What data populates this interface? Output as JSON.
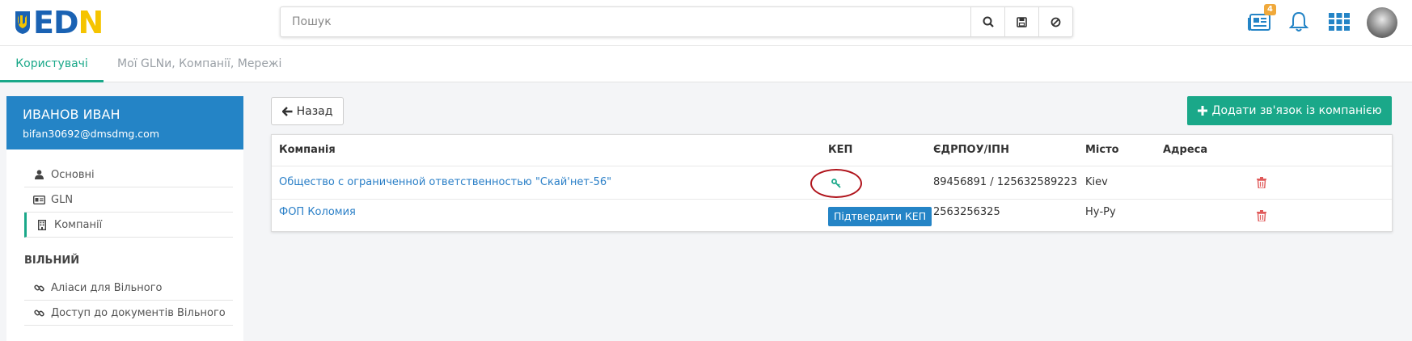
{
  "header": {
    "logo_text_1": "ED",
    "logo_text_2": "N",
    "search_placeholder": "Пошук",
    "notification_badge": "4",
    "icons": [
      "search-icon",
      "save-icon",
      "block-icon",
      "news-icon",
      "bell-icon",
      "apps-grid-icon",
      "avatar"
    ]
  },
  "tabs": [
    {
      "label": "Користувачі",
      "active": true
    },
    {
      "label": "Мої GLNи, Компанії, Мережі",
      "active": false
    }
  ],
  "user": {
    "name": "ИВАНОВ ИВАН",
    "email": "bifan30692@dmsdmg.com"
  },
  "menu": [
    {
      "label": "Основні",
      "icon": "user-icon"
    },
    {
      "label": "GLN",
      "icon": "id-card-icon"
    },
    {
      "label": "Компанії",
      "icon": "building-icon",
      "active": true
    }
  ],
  "section2": {
    "title": "ВІЛЬНИЙ",
    "items": [
      {
        "label": "Аліаси для Вільного",
        "icon": "link-icon"
      },
      {
        "label": "Доступ до документів Вільного",
        "icon": "link-icon"
      }
    ]
  },
  "actions": {
    "back": "Назад",
    "add": "Додати зв'язок із компанією"
  },
  "table": {
    "headers": [
      "Компанія",
      "КЕП",
      "ЄДРПОУ/ІПН",
      "Місто",
      "Адреса"
    ],
    "rows": [
      {
        "company": "Общество с ограниченной ответственностью \"Скай'нет-56\"",
        "kep": "key-icon",
        "code": "89456891 / 125632589223",
        "city": "Kiev",
        "address": ""
      },
      {
        "company": "ФОП Коломия",
        "kep_button": "Підтвердити КЕП",
        "code": "2563256325",
        "city": "Ну-Ру",
        "address": ""
      }
    ]
  },
  "colors": {
    "accent_green": "#1aa889",
    "primary_blue": "#2484c6",
    "link_blue": "#2a7fc7",
    "danger_red": "#e05a5a",
    "highlight_ring": "#b0141c",
    "badge_orange": "#f0a93b"
  }
}
